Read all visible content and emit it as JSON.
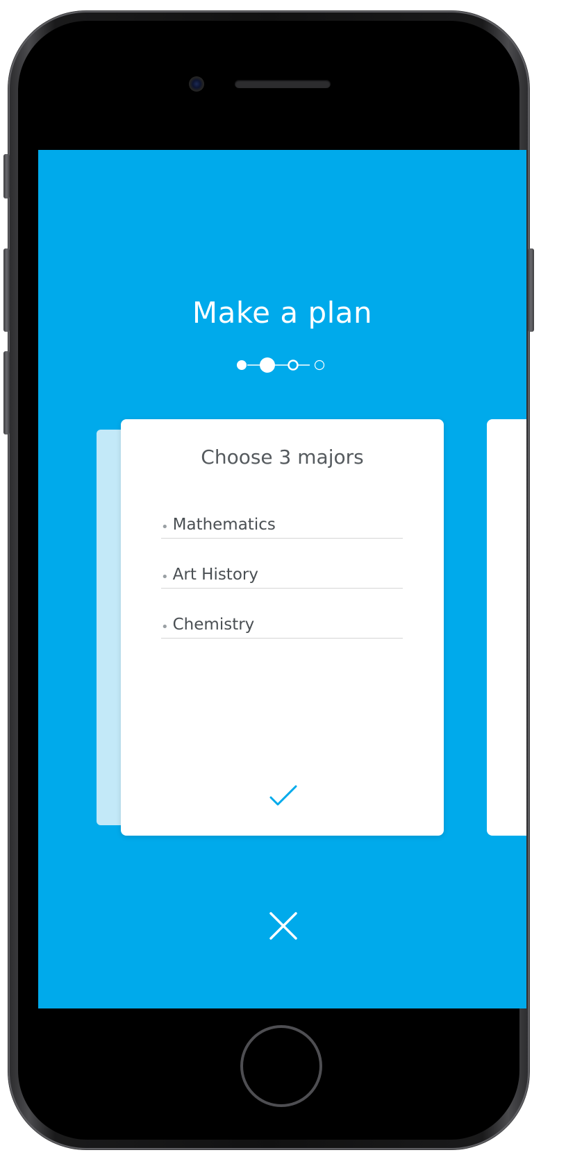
{
  "screen": {
    "title": "Make a plan",
    "background_color": "#00aaeb",
    "stepper": {
      "total_steps": 4,
      "current_step": 2,
      "completed_steps": 1
    },
    "card": {
      "title": "Choose 3 majors",
      "majors": [
        {
          "label": "Mathematics"
        },
        {
          "label": "Art History"
        },
        {
          "label": "Chemistry"
        }
      ],
      "bullet": "•",
      "confirm_icon": "checkmark-icon",
      "confirm_color": "#00aaeb"
    },
    "close_icon": "close-icon"
  },
  "device": {
    "type": "phone",
    "home_button": true
  }
}
